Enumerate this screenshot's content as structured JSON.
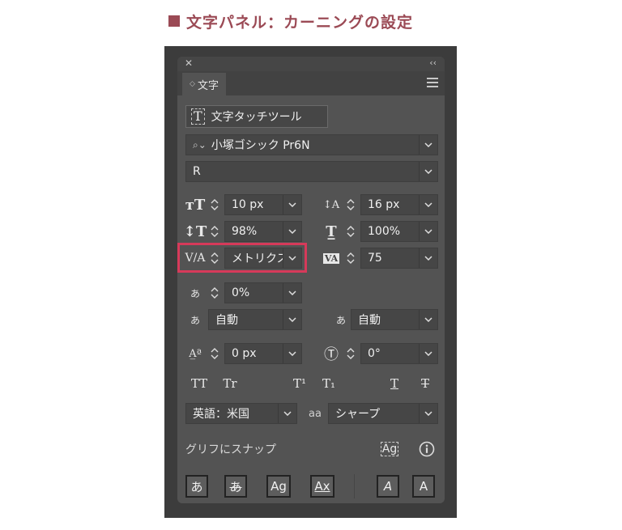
{
  "heading": "文字パネル：カーニングの設定",
  "panel": {
    "close_icon": "close-icon",
    "collapse_text": "‹‹",
    "tab_label": "文字",
    "touch_tool_label": "文字タッチツール",
    "font_family": "小塚ゴシック Pr6N",
    "font_style": "R",
    "font_size": "10 px",
    "leading": "16 px",
    "vertical_scale": "98%",
    "horizontal_scale": "100%",
    "kerning": "メトリクス",
    "tracking": "75",
    "tsume": "0%",
    "aki_left": "自動",
    "aki_right": "自動",
    "baseline_shift": "0 px",
    "rotation": "0°",
    "language": "英語：米国",
    "anti_alias": "シャープ",
    "aa_glyph": "aa",
    "snap_label": "グリフにスナップ",
    "glyph_tt": "TT",
    "glyph_tr": "Tr",
    "glyph_sup": "T¹",
    "glyph_sub": "T₁",
    "glyph_under": "T",
    "glyph_strike": "T",
    "btn_a": "あ",
    "btn_a2": "あ",
    "btn_ag": "Ag",
    "btn_ax": "Ax",
    "btn_ital": "A",
    "btn_a3": "A"
  },
  "colors": {
    "heading": "#9b4a55",
    "highlight": "#d63a5a",
    "panel_bg": "#535353"
  }
}
